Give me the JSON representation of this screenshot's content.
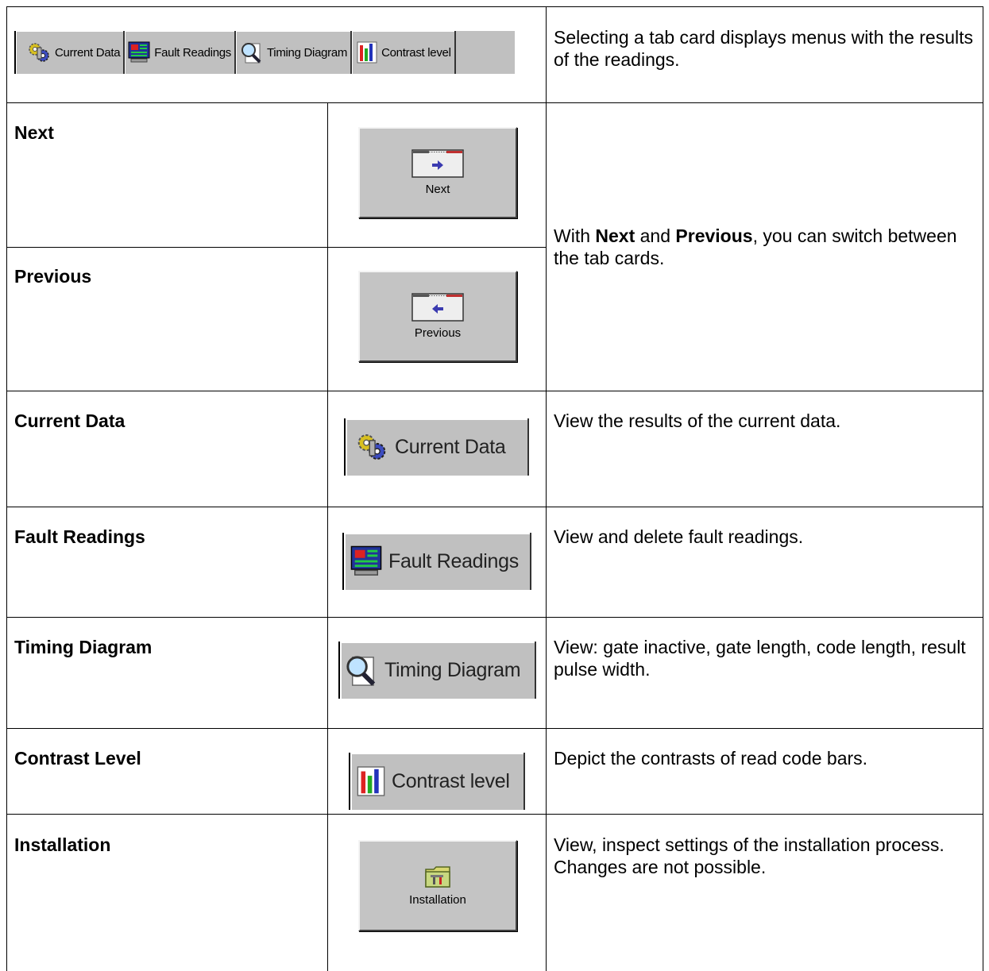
{
  "tab_strip": {
    "tabs": [
      {
        "label": "Current Data",
        "icon": "gears-icon"
      },
      {
        "label": "Fault Readings",
        "icon": "monitor-icon"
      },
      {
        "label": "Timing Diagram",
        "icon": "magnifier-document-icon"
      },
      {
        "label": "Contrast level",
        "icon": "bar-chart-icon"
      }
    ],
    "description": "Selecting a tab card displays menus with the results of the readings."
  },
  "rows": [
    {
      "label": "Next",
      "button_caption": "Next",
      "icon": "window-arrow-right-icon"
    },
    {
      "label": "Previous",
      "button_caption": "Previous",
      "icon": "window-arrow-left-icon"
    },
    {
      "label": "Current Data",
      "tab_caption": "Current Data",
      "icon": "gears-icon",
      "description": "View the results of the current data."
    },
    {
      "label": "Fault Readings",
      "tab_caption": "Fault Readings",
      "icon": "monitor-icon",
      "description": "View and delete fault readings."
    },
    {
      "label": "Timing Diagram",
      "tab_caption": "Timing Diagram",
      "icon": "magnifier-document-icon",
      "description": "View: gate inactive, gate length, code length, result pulse width."
    },
    {
      "label": "Contrast Level",
      "tab_caption": "Contrast level",
      "icon": "bar-chart-icon",
      "description": "Depict the contrasts of read code bars."
    },
    {
      "label": "Installation",
      "button_caption": "Installation",
      "icon": "folder-tools-icon",
      "description": "View, inspect settings of the installation process. Changes are not possible."
    }
  ],
  "next_previous_description": {
    "pre": "With ",
    "next": "Next",
    "mid": " and ",
    "previous": "Previous",
    "post": ", you can switch between the tab cards."
  }
}
